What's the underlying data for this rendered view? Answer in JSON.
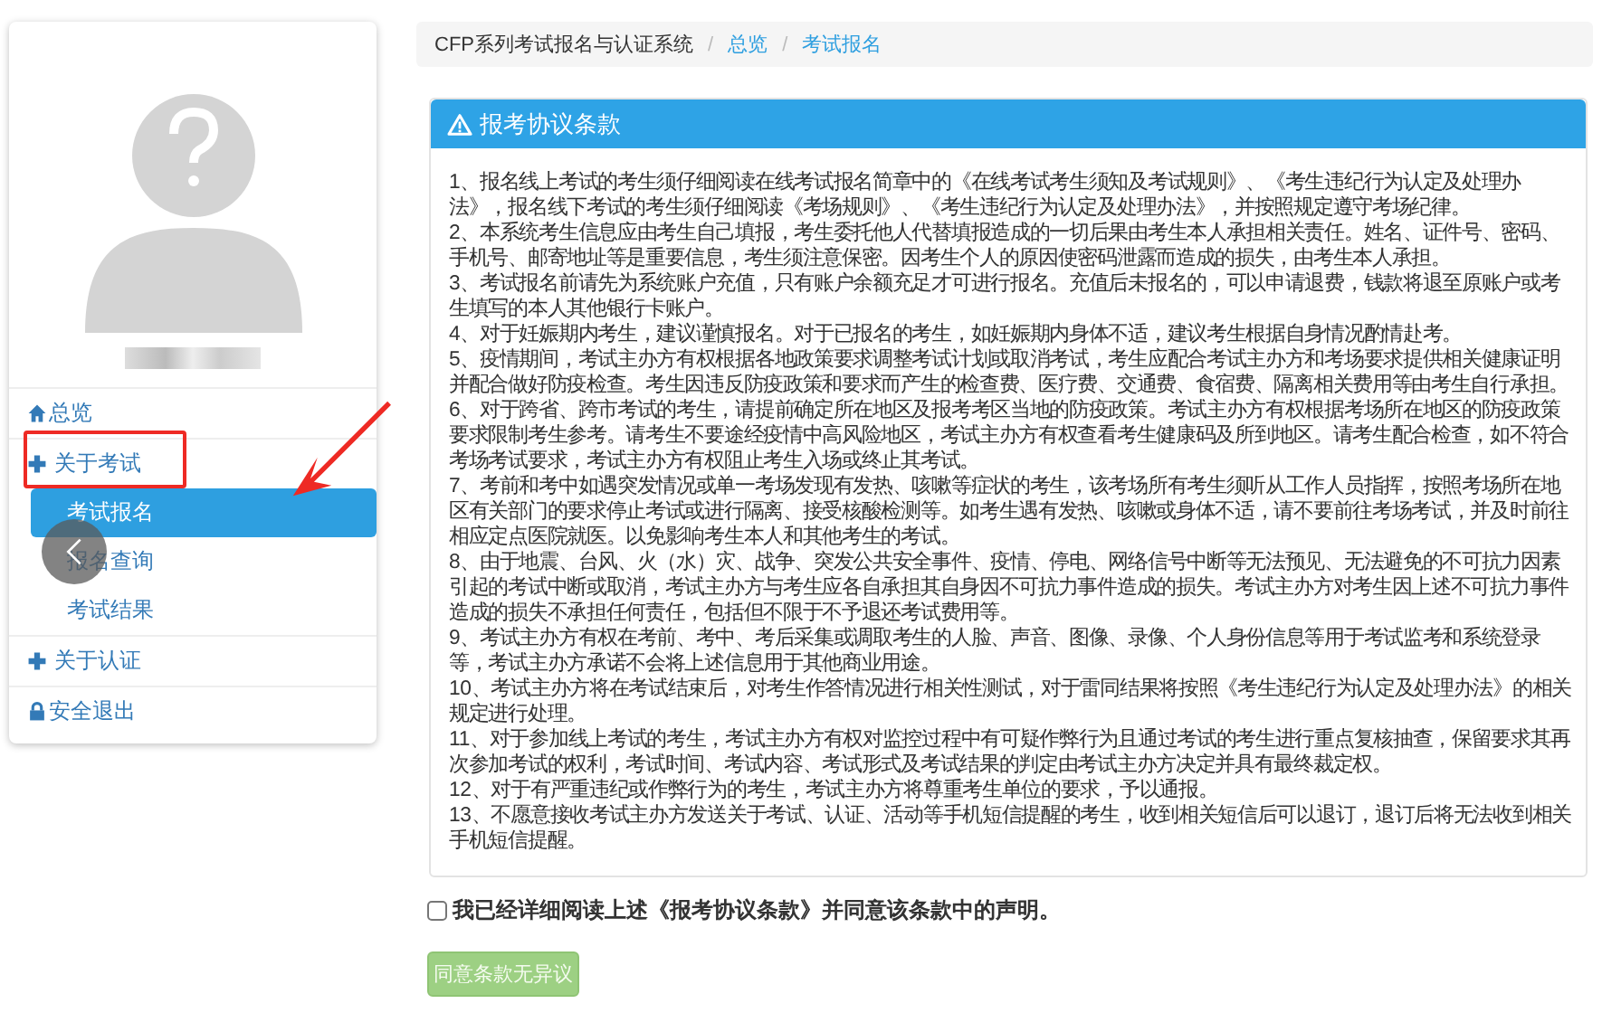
{
  "sidebar": {
    "items": [
      {
        "kind": "home",
        "label": "总览",
        "selected": false
      },
      {
        "kind": "group",
        "label": "关于考试",
        "selected": false
      },
      {
        "kind": "sub",
        "label": "考试报名",
        "selected": true
      },
      {
        "kind": "sub",
        "label": "报名查询",
        "selected": false
      },
      {
        "kind": "sub",
        "label": "考试结果",
        "selected": false
      },
      {
        "kind": "group",
        "label": "关于认证",
        "selected": false
      },
      {
        "kind": "exit",
        "label": "安全退出",
        "selected": false
      }
    ]
  },
  "breadcrumb": {
    "separator": "/",
    "items": [
      {
        "label": "CFP系列考试报名与认证系统",
        "link": false
      },
      {
        "label": "总览",
        "link": true
      },
      {
        "label": "考试报名",
        "link": true
      }
    ]
  },
  "panel": {
    "title": "报考协议条款",
    "terms": [
      "1、报名线上考试的考生须仔细阅读在线考试报名简章中的《在线考试考生须知及考试规则》、《考生违纪行为认定及处理办法》，报名线下考试的考生须仔细阅读《考场规则》、《考生违纪行为认定及处理办法》，并按照规定遵守考场纪律。",
      "2、本系统考生信息应由考生自己填报，考生委托他人代替填报造成的一切后果由考生本人承担相关责任。姓名、证件号、密码、手机号、邮寄地址等是重要信息，考生须注意保密。因考生个人的原因使密码泄露而造成的损失，由考生本人承担。",
      "3、考试报名前请先为系统账户充值，只有账户余额充足才可进行报名。充值后未报名的，可以申请退费，钱款将退至原账户或考生填写的本人其他银行卡账户。",
      "4、对于妊娠期内考生，建议谨慎报名。对于已报名的考生，如妊娠期内身体不适，建议考生根据自身情况酌情赴考。",
      "5、疫情期间，考试主办方有权根据各地政策要求调整考试计划或取消考试，考生应配合考试主办方和考场要求提供相关健康证明并配合做好防疫检查。考生因违反防疫政策和要求而产生的检查费、医疗费、交通费、食宿费、隔离相关费用等由考生自行承担。",
      "6、对于跨省、跨市考试的考生，请提前确定所在地区及报考考区当地的防疫政策。考试主办方有权根据考场所在地区的防疫政策要求限制考生参考。请考生不要途经疫情中高风险地区，考试主办方有权查看考生健康码及所到地区。请考生配合检查，如不符合考场考试要求，考试主办方有权阻止考生入场或终止其考试。",
      "7、考前和考中如遇突发情况或单一考场发现有发热、咳嗽等症状的考生，该考场所有考生须听从工作人员指挥，按照考场所在地区有关部门的要求停止考试或进行隔离、接受核酸检测等。如考生遇有发热、咳嗽或身体不适，请不要前往考场考试，并及时前往相应定点医院就医。以免影响考生本人和其他考生的考试。",
      "8、由于地震、台风、火（水）灾、战争、突发公共安全事件、疫情、停电、网络信号中断等无法预见、无法避免的不可抗力因素引起的考试中断或取消，考试主办方与考生应各自承担其自身因不可抗力事件造成的损失。考试主办方对考生因上述不可抗力事件造成的损失不承担任何责任，包括但不限于不予退还考试费用等。",
      "9、考试主办方有权在考前、考中、考后采集或调取考生的人脸、声音、图像、录像、个人身份信息等用于考试监考和系统登录等，考试主办方承诺不会将上述信息用于其他商业用途。",
      "10、考试主办方将在考试结束后，对考生作答情况进行相关性测试，对于雷同结果将按照《考生违纪行为认定及处理办法》的相关规定进行处理。",
      "11、对于参加线上考试的考生，考试主办方有权对监控过程中有可疑作弊行为且通过考试的考生进行重点复核抽查，保留要求其再次参加考试的权利，考试时间、考试内容、考试形式及考试结果的判定由考试主办方决定并具有最终裁定权。",
      "12、对于有严重违纪或作弊行为的考生，考试主办方将尊重考生单位的要求，予以通报。",
      "13、不愿意接收考试主办方发送关于考试、认证、活动等手机短信提醒的考生，收到相关短信后可以退订，退订后将无法收到相关手机短信提醒。"
    ]
  },
  "agree": {
    "label": "我已经详细阅读上述《报考协议条款》并同意该条款中的声明。",
    "checked": false
  },
  "submit": {
    "label": "同意条款无异议",
    "disabled": true
  }
}
